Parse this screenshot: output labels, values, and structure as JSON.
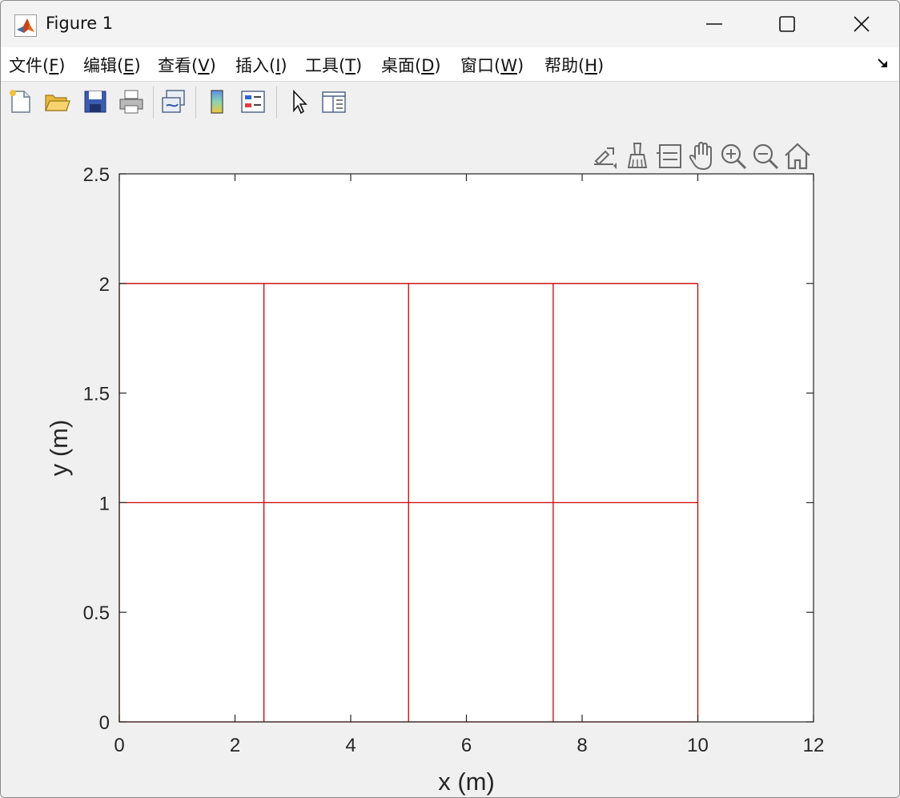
{
  "window": {
    "title": "Figure 1"
  },
  "menu": [
    {
      "pre": "文件(",
      "key": "F",
      "post": ")"
    },
    {
      "pre": "编辑(",
      "key": "E",
      "post": ")"
    },
    {
      "pre": "查看(",
      "key": "V",
      "post": ")"
    },
    {
      "pre": "插入(",
      "key": "I",
      "post": ")"
    },
    {
      "pre": "工具(",
      "key": "T",
      "post": ")"
    },
    {
      "pre": "桌面(",
      "key": "D",
      "post": ")"
    },
    {
      "pre": "窗口(",
      "key": "W",
      "post": ")"
    },
    {
      "pre": "帮助(",
      "key": "H",
      "post": ")"
    }
  ],
  "toolbar": {
    "buttons": [
      "new-figure-icon",
      "open-file-icon",
      "save-icon",
      "print-icon",
      "link-plot-icon",
      "colorbar-icon",
      "legend-icon",
      "pointer-icon",
      "property-inspector-icon"
    ]
  },
  "axes_toolbar": {
    "buttons": [
      "brush-export-icon",
      "data-brush-icon",
      "data-tip-icon",
      "pan-hand-icon",
      "zoom-in-icon",
      "zoom-out-icon",
      "home-icon"
    ]
  },
  "colors": {
    "line": "#cc0000",
    "axes_bg": "#ffffff",
    "figure_bg": "#f0f0f0"
  },
  "chart_data": {
    "type": "line",
    "title": "",
    "xlabel": "x (m)",
    "ylabel": "y (m)",
    "xlim": [
      0,
      12
    ],
    "ylim": [
      0,
      2.5
    ],
    "xticks": [
      "0",
      "2",
      "4",
      "6",
      "8",
      "10",
      "12"
    ],
    "xtick_values": [
      0,
      2,
      4,
      6,
      8,
      10,
      12
    ],
    "yticks": [
      "0",
      "0.5",
      "1",
      "1.5",
      "2",
      "2.5"
    ],
    "ytick_values": [
      0,
      0.5,
      1,
      1.5,
      2,
      2.5
    ],
    "grid": false,
    "series": [
      {
        "x": [
          0,
          10
        ],
        "y": [
          0,
          0
        ]
      },
      {
        "x": [
          0,
          10
        ],
        "y": [
          1,
          1
        ]
      },
      {
        "x": [
          0,
          10
        ],
        "y": [
          2,
          2
        ]
      },
      {
        "x": [
          0,
          0
        ],
        "y": [
          0,
          2
        ]
      },
      {
        "x": [
          2.5,
          2.5
        ],
        "y": [
          0,
          2
        ]
      },
      {
        "x": [
          5,
          5
        ],
        "y": [
          0,
          2
        ]
      },
      {
        "x": [
          7.5,
          7.5
        ],
        "y": [
          0,
          2
        ]
      },
      {
        "x": [
          10,
          10
        ],
        "y": [
          0,
          2
        ]
      }
    ]
  }
}
